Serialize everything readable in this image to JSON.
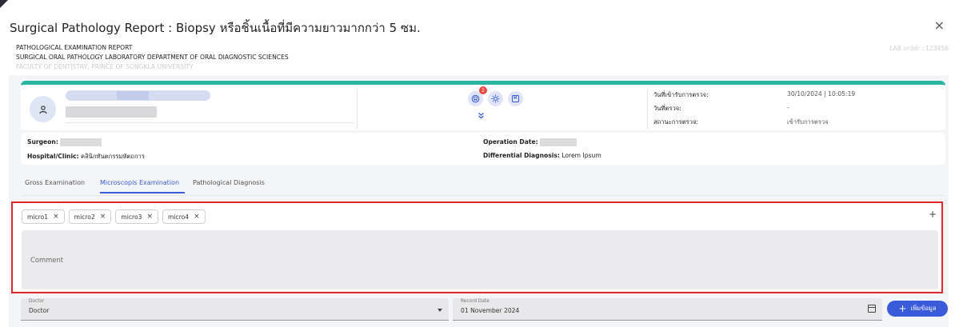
{
  "dialog": {
    "title": "Surgical Pathology Report : Biopsy หรือชิ้นเนื้อที่มีความยาวมากกว่า 5 ซม.",
    "close_icon": "×"
  },
  "report_header": {
    "line1": "PATHOLOGICAL EXAMINATION REPORT",
    "line2": "SURGICAL ORAL PATHOLOGY LABORATORY DEPARTMENT OF ORAL DIAGNOSTIC SCIENCES",
    "line3": "FACULTY OF DENTISTRY, PRINCE OF SONGKLA UNIVERSITY",
    "lab_order": "LAB order : 123456"
  },
  "patient": {
    "avatar_icon": "user-icon",
    "action_icons": [
      "tooth-icon",
      "settings-icon",
      "bookmark-icon"
    ],
    "notification_count": "2",
    "expand_icon": "»",
    "info": [
      {
        "label": "วันที่เข้ารับการตรวจ:",
        "value": "30/10/2024 | 10:05:19"
      },
      {
        "label": "วันที่ตรวจ:",
        "value": "-"
      },
      {
        "label": "สถานะการตรวจ:",
        "value": "เข้ารับการตรวจ"
      }
    ]
  },
  "surgery": {
    "surgeon_label": "Surgeon:",
    "hospital_label": "Hospital/Clinic:",
    "hospital_value": "คลินิกทันตกรรมหัตถการ",
    "operation_date_label": "Operation Date:",
    "diff_label": "Differential Diagnosis:",
    "diff_value": "Lorem Ipsum"
  },
  "tabs": [
    {
      "label": "Gross Examination"
    },
    {
      "label": "Microscopis Examination",
      "active": true
    },
    {
      "label": "Pathological Diagnosis"
    }
  ],
  "microscopic": {
    "chips": [
      "micro1",
      "micro2",
      "micro3",
      "micro4"
    ],
    "chip_remove": "×",
    "add_icon": "+",
    "comment_placeholder": "Comment"
  },
  "footer": {
    "doctor_label": "Doctor",
    "doctor_value": "Doctor",
    "record_date_label": "Record Date",
    "record_date_value": "01 November 2024",
    "add_button_label": "เพิ่มข้อมูล",
    "add_button_icon": "+"
  },
  "colors": {
    "accent": "#3a5bd9",
    "teal": "#2bb5a0",
    "highlight_border": "#e4252a",
    "badge": "#e8483e"
  }
}
